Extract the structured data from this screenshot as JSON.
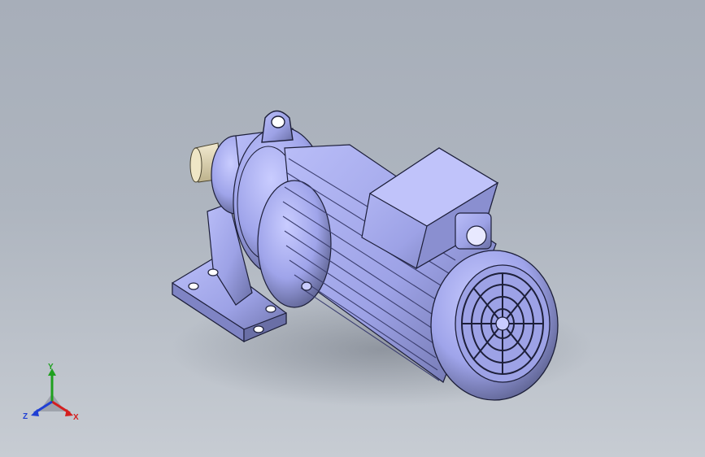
{
  "viewport": {
    "background_top": "#a7aeb9",
    "background_bottom": "#c7ccd3",
    "model_color": "#a9aef0",
    "model_shadow": "#5d6290",
    "model_outline": "#1d1f3a"
  },
  "model": {
    "name": "gear-reducer-motor",
    "parts": [
      "output-shaft",
      "reducer-housing",
      "foot-mount",
      "lifting-eye",
      "motor-body",
      "terminal-box",
      "fan-cover"
    ]
  },
  "triad": {
    "x_label": "X",
    "y_label": "Y",
    "z_label": "Z",
    "x_color": "#d41f1f",
    "y_color": "#1fa01f",
    "z_color": "#1f3fd4"
  }
}
